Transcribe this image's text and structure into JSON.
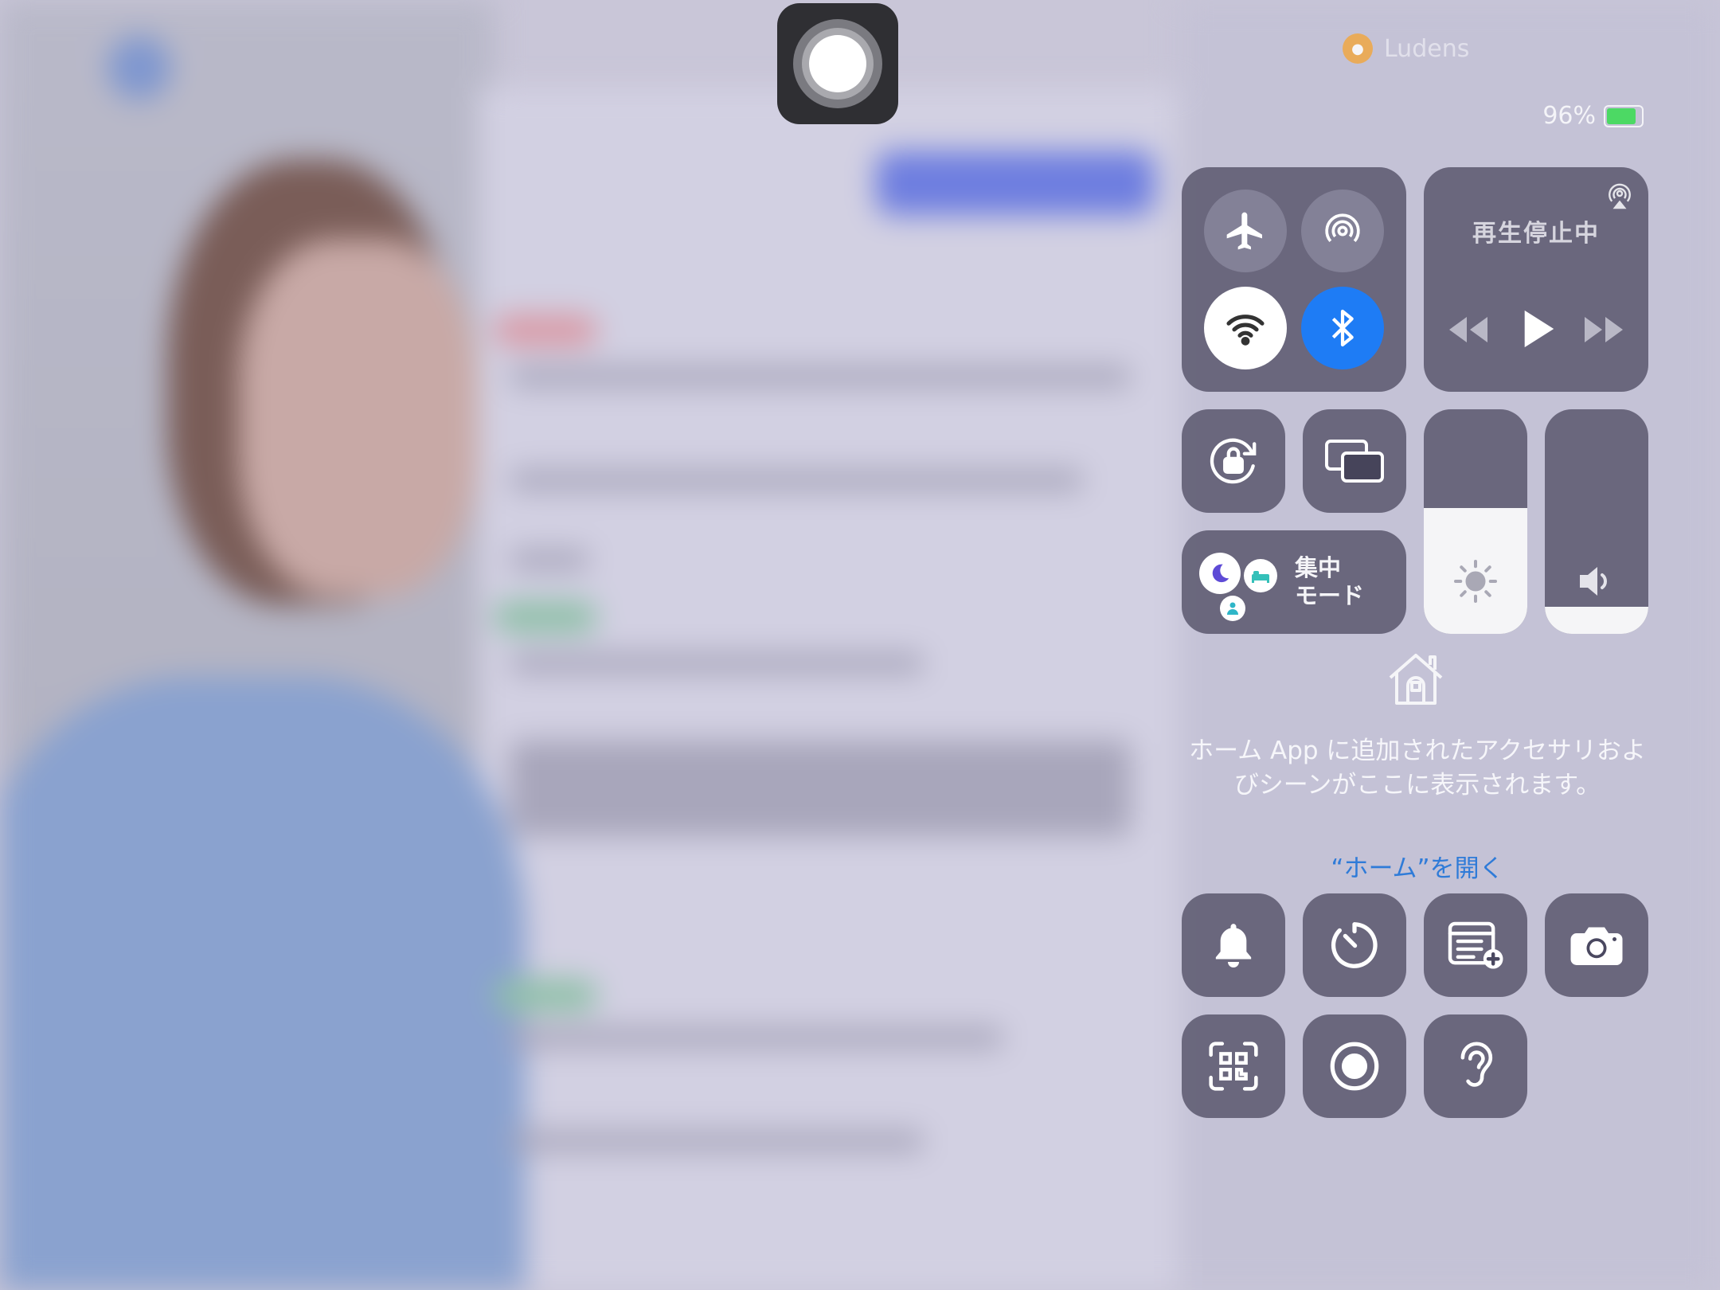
{
  "status_bar": {
    "battery_percent": "96%",
    "siri_app_label": "Ludens"
  },
  "connectivity": {
    "airplane_mode": "off",
    "airdrop": "off",
    "wifi": "on",
    "bluetooth": "on"
  },
  "media": {
    "title": "再生停止中"
  },
  "focus": {
    "label_line1": "集中",
    "label_line2": "モード"
  },
  "sliders": {
    "brightness_level": 0.56,
    "volume_level": 0.12
  },
  "home": {
    "message": "ホーム App に追加されたアクセサリおよびシーンがここに表示されます。",
    "open_link": "“ホーム”を開く"
  },
  "colors": {
    "accent_blue": "#1e7cf5",
    "link_blue": "#2f7bd8",
    "battery_green": "#4cd964"
  }
}
